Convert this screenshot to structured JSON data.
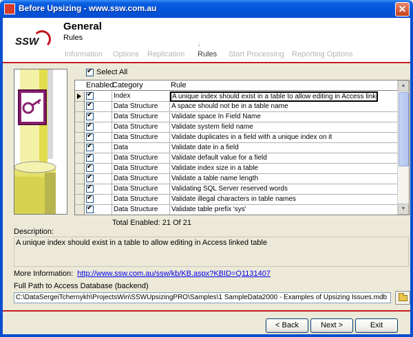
{
  "window": {
    "title": "Before Upsizing - www.ssw.com.au",
    "close_glyph": "✕"
  },
  "header": {
    "logo_text": "SSW",
    "title": "General",
    "subtitle": "Rules",
    "step_marker_glyph": "↓",
    "steps": [
      {
        "label": "Information",
        "active": false
      },
      {
        "label": "Options",
        "active": false
      },
      {
        "label": "Replication",
        "active": false
      },
      {
        "label": "Rules",
        "active": true
      },
      {
        "label": "Start Processing",
        "active": false
      },
      {
        "label": "Reporting Options",
        "active": false
      }
    ]
  },
  "select_all": {
    "label": "Select All",
    "checked": true
  },
  "grid": {
    "columns": [
      "Enabled",
      "Category",
      "Rule"
    ],
    "rows": [
      {
        "enabled": true,
        "category": "Index",
        "rule": "A unique index should exist in a table to allow editing in Access linked table",
        "current": true
      },
      {
        "enabled": true,
        "category": "Data Structure",
        "rule": "A space should not be in a table name"
      },
      {
        "enabled": true,
        "category": "Data Structure",
        "rule": "Validate space In Field Name"
      },
      {
        "enabled": true,
        "category": "Data Structure",
        "rule": "Validate system field name"
      },
      {
        "enabled": true,
        "category": "Data Structure",
        "rule": "Validate duplicates in a field with a unique index on it"
      },
      {
        "enabled": true,
        "category": "Data",
        "rule": "Validate date in a field"
      },
      {
        "enabled": true,
        "category": "Data Structure",
        "rule": "Validate default value for a field"
      },
      {
        "enabled": true,
        "category": "Data Structure",
        "rule": "Validate index size in a table"
      },
      {
        "enabled": true,
        "category": "Data Structure",
        "rule": "Validate a table name length"
      },
      {
        "enabled": true,
        "category": "Data Structure",
        "rule": "Validating SQL Server reserved words"
      },
      {
        "enabled": true,
        "category": "Data Structure",
        "rule": "Validate illegal characters in table names"
      },
      {
        "enabled": true,
        "category": "Data Structure",
        "rule": "Validate table prefix 'sys'"
      }
    ]
  },
  "total": {
    "label": "Total Enabled:",
    "value": "21 Of 21"
  },
  "description": {
    "label": "Description:",
    "text": "A unique index should exist in a table to allow editing in Access linked table"
  },
  "more_info": {
    "label": "More Information:",
    "link": "http://www.ssw.com.au/ssw/kb/KB.aspx?KBID=Q1131407"
  },
  "path": {
    "label": "Full Path to Access Database (backend)",
    "value": "C:\\DataSergeiTchernykh\\ProjectsWin\\SSWUpsizingPRO\\Samples\\1 SampleData2000 - Examples of Upsizing Issues.mdb"
  },
  "buttons": {
    "back": "< Back",
    "next": "Next >",
    "exit": "Exit"
  },
  "colors": {
    "accent_rule": "#c31d1d",
    "titlebar": "#0052d8",
    "window_bg": "#ece9d8"
  }
}
